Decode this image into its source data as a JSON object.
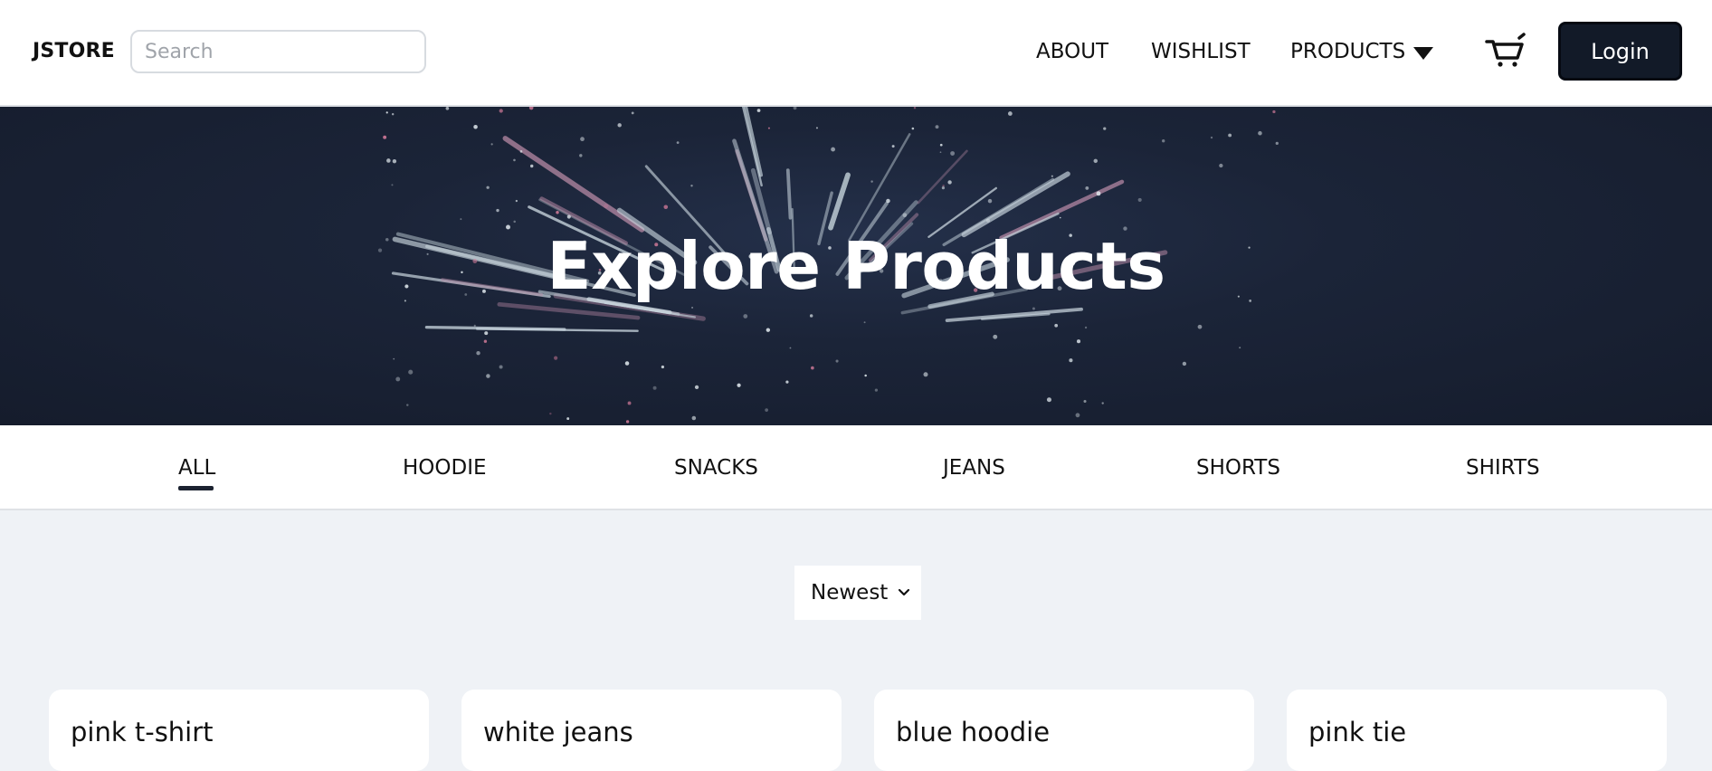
{
  "header": {
    "brand": "JSTORE",
    "search_placeholder": "Search",
    "search_value": "",
    "nav": {
      "about": "ABOUT",
      "wishlist": "WISHLIST",
      "products": "PRODUCTS"
    },
    "login_label": "Login",
    "icons": {
      "products_dropdown": "caret-down-icon",
      "cart": "cart-icon"
    }
  },
  "hero": {
    "title": "Explore Products"
  },
  "categories": [
    "ALL",
    "HOODIE",
    "SNACKS",
    "JEANS",
    "SHORTS",
    "SHIRTS"
  ],
  "active_category": "ALL",
  "sort": {
    "selected": "Newest"
  },
  "products": [
    {
      "name": "pink t-shirt"
    },
    {
      "name": "white jeans"
    },
    {
      "name": "blue hoodie"
    },
    {
      "name": "pink tie"
    }
  ],
  "colors": {
    "header_bg": "#ffffff",
    "login_bg": "#121a28",
    "hero_bg": "#1b2438",
    "page_bg": "#eff2f6",
    "tab_underline": "#1b2230"
  }
}
